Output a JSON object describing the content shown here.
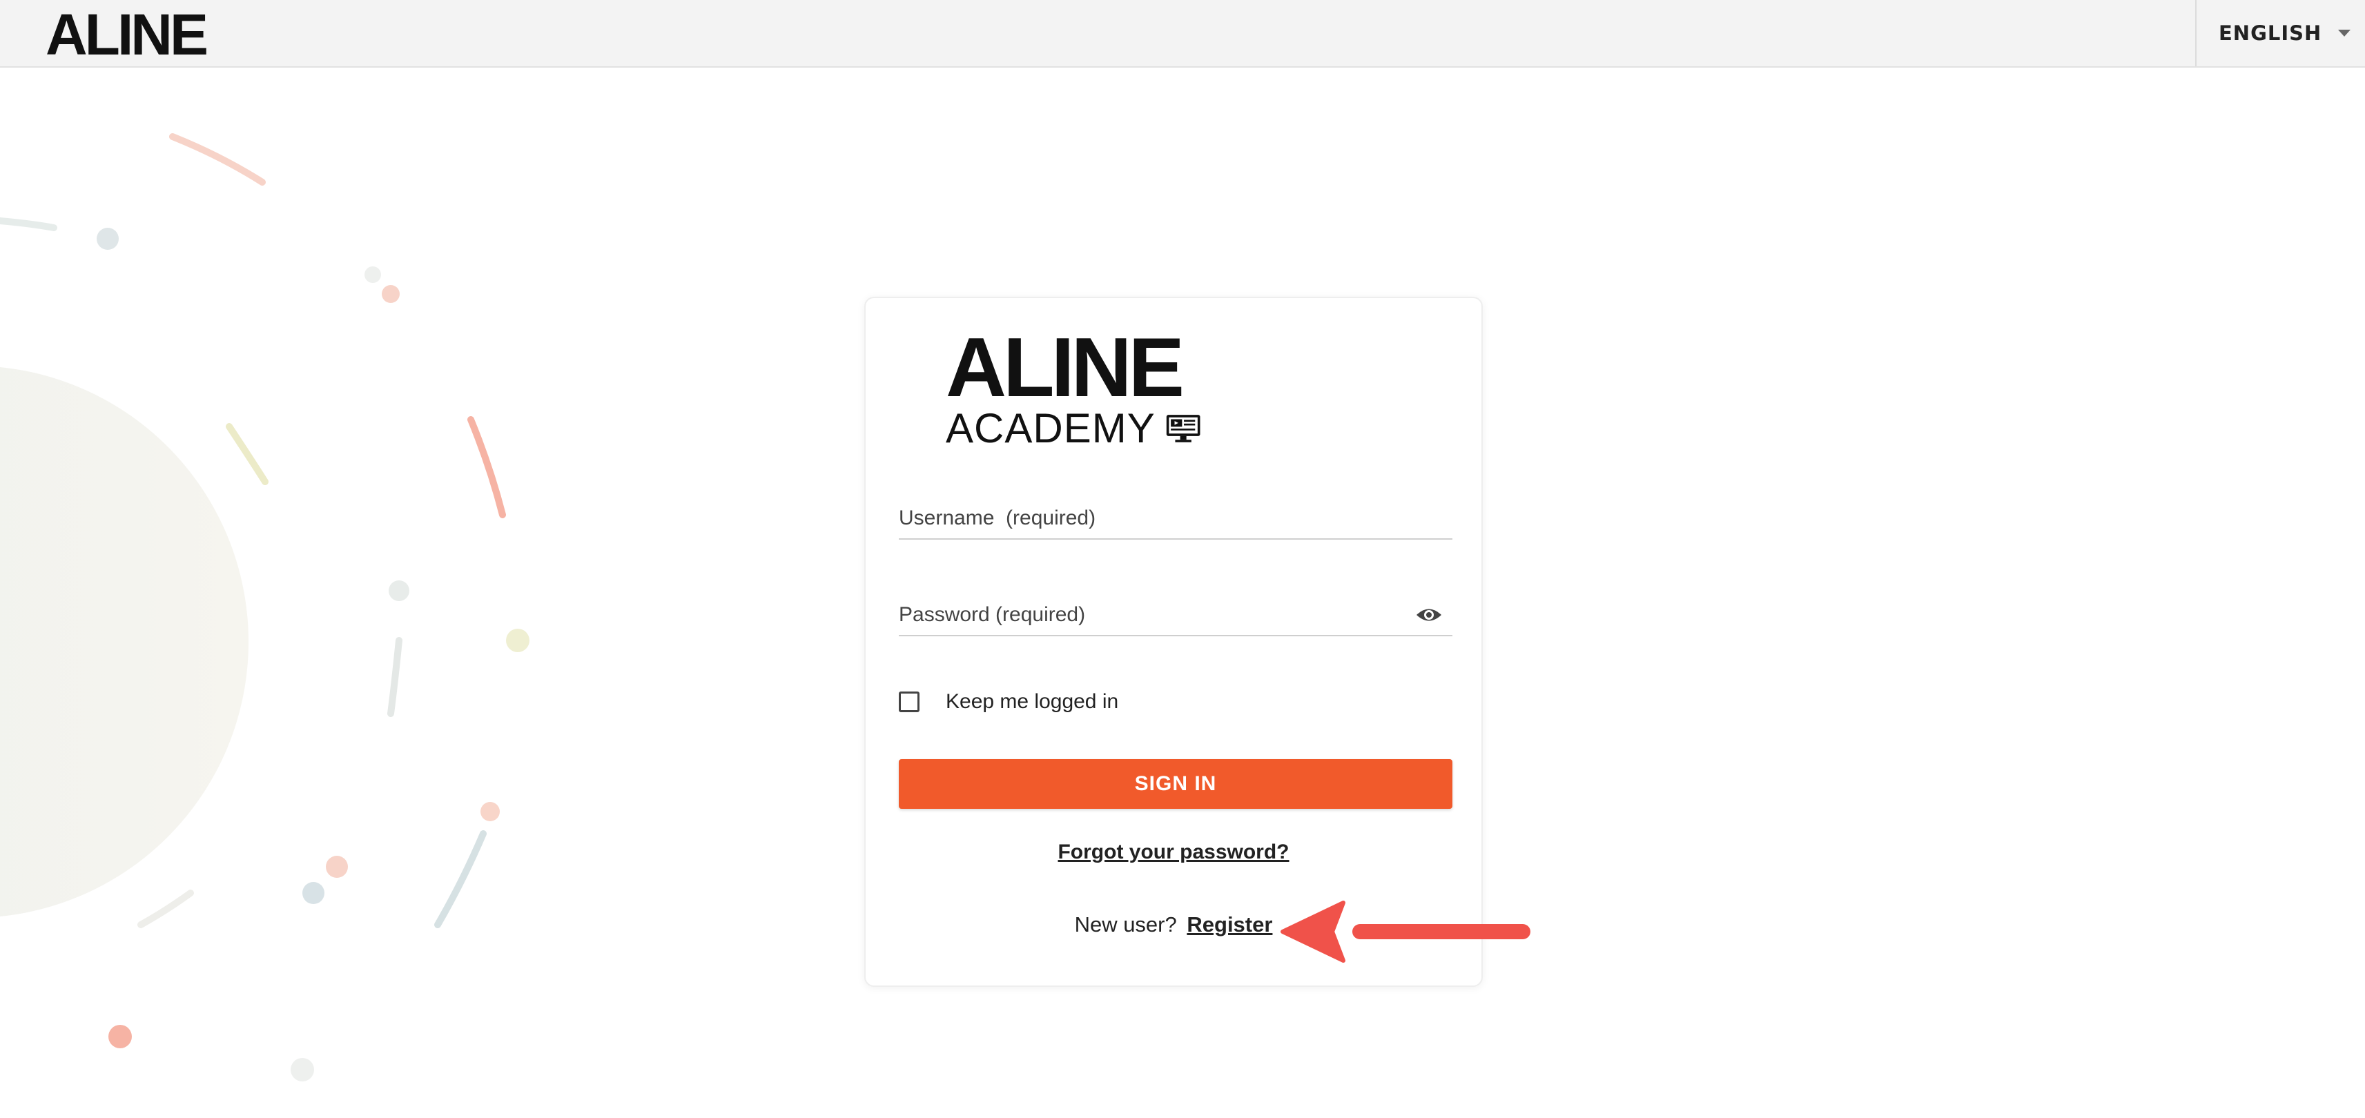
{
  "header": {
    "brand": "ALINE",
    "language": "ENGLISH"
  },
  "logo": {
    "main": "ALINE",
    "sub": "ACADEMY"
  },
  "form": {
    "username_placeholder": "Username  (required)",
    "password_placeholder": "Password (required)",
    "remember_label": "Keep me logged in",
    "signin_label": "SIGN IN",
    "forgot_label": "Forgot your password?",
    "new_user_text": "New user?",
    "register_label": "Register"
  },
  "icons": {
    "language_caret": "chevron-down-icon",
    "password_toggle": "eye-icon",
    "logo_monitor": "monitor-icon",
    "annotation": "arrow-left-icon"
  },
  "colors": {
    "accent": "#f15a2b",
    "annotation_arrow": "#f0524a",
    "topbar_bg": "#f3f3f3"
  }
}
